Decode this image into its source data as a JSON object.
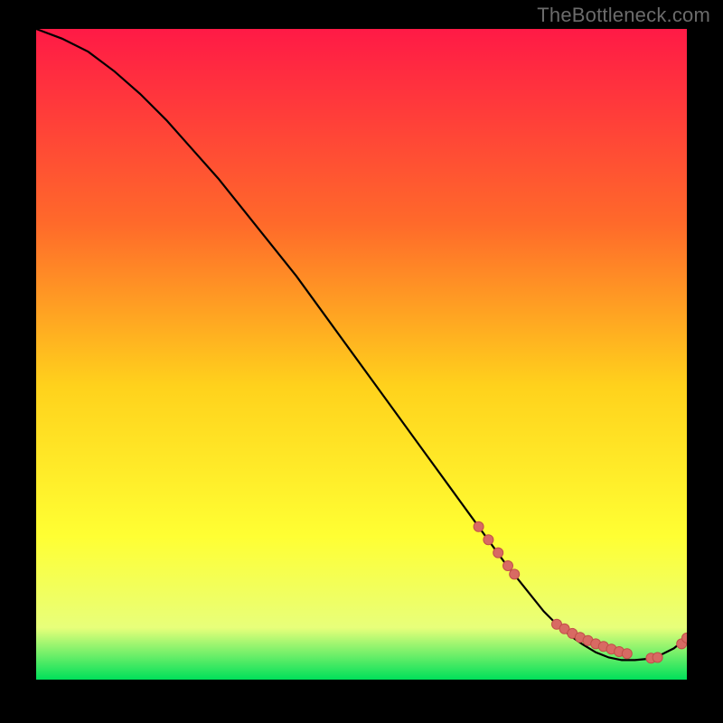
{
  "watermark": "TheBottleneck.com",
  "colors": {
    "background": "#000000",
    "watermark_text": "#6b6b6b",
    "gradient_top": "#ff1a46",
    "gradient_mid1": "#ff6a2a",
    "gradient_mid2": "#ffd21c",
    "gradient_mid3": "#ffff33",
    "gradient_mid4": "#e8ff7a",
    "gradient_bottom": "#00e05a",
    "curve": "#000000",
    "marker_fill": "#d86a63",
    "marker_stroke": "#c24f49"
  },
  "chart_data": {
    "type": "line",
    "title": "",
    "xlabel": "",
    "ylabel": "",
    "xlim": [
      0,
      100
    ],
    "ylim": [
      0,
      100
    ],
    "grid": false,
    "legend": false,
    "series": [
      {
        "name": "bottleneck-curve",
        "x": [
          0,
          4,
          8,
          12,
          16,
          20,
          24,
          28,
          32,
          36,
          40,
          44,
          48,
          52,
          56,
          60,
          64,
          68,
          72,
          74,
          76,
          78,
          80,
          82,
          84,
          86,
          88,
          90,
          92,
          94,
          96,
          98,
          100
        ],
        "y": [
          100,
          98.5,
          96.5,
          93.5,
          90,
          86,
          81.5,
          77,
          72,
          67,
          62,
          56.5,
          51,
          45.5,
          40,
          34.5,
          29,
          23.5,
          18,
          15.5,
          13,
          10.5,
          8.5,
          6.8,
          5.4,
          4.2,
          3.4,
          3.0,
          3.0,
          3.2,
          3.8,
          4.8,
          6.4
        ]
      }
    ],
    "markers": {
      "name": "highlight-points",
      "x": [
        68,
        69.5,
        71,
        72.5,
        73.5,
        80,
        81.2,
        82.4,
        83.6,
        84.8,
        86,
        87.2,
        88.4,
        89.6,
        90.8,
        94.5,
        95.5,
        99.2,
        100
      ],
      "y": [
        23.5,
        21.5,
        19.5,
        17.5,
        16.2,
        8.5,
        7.8,
        7.1,
        6.5,
        6.0,
        5.5,
        5.1,
        4.7,
        4.3,
        4.0,
        3.3,
        3.4,
        5.5,
        6.4
      ]
    }
  }
}
